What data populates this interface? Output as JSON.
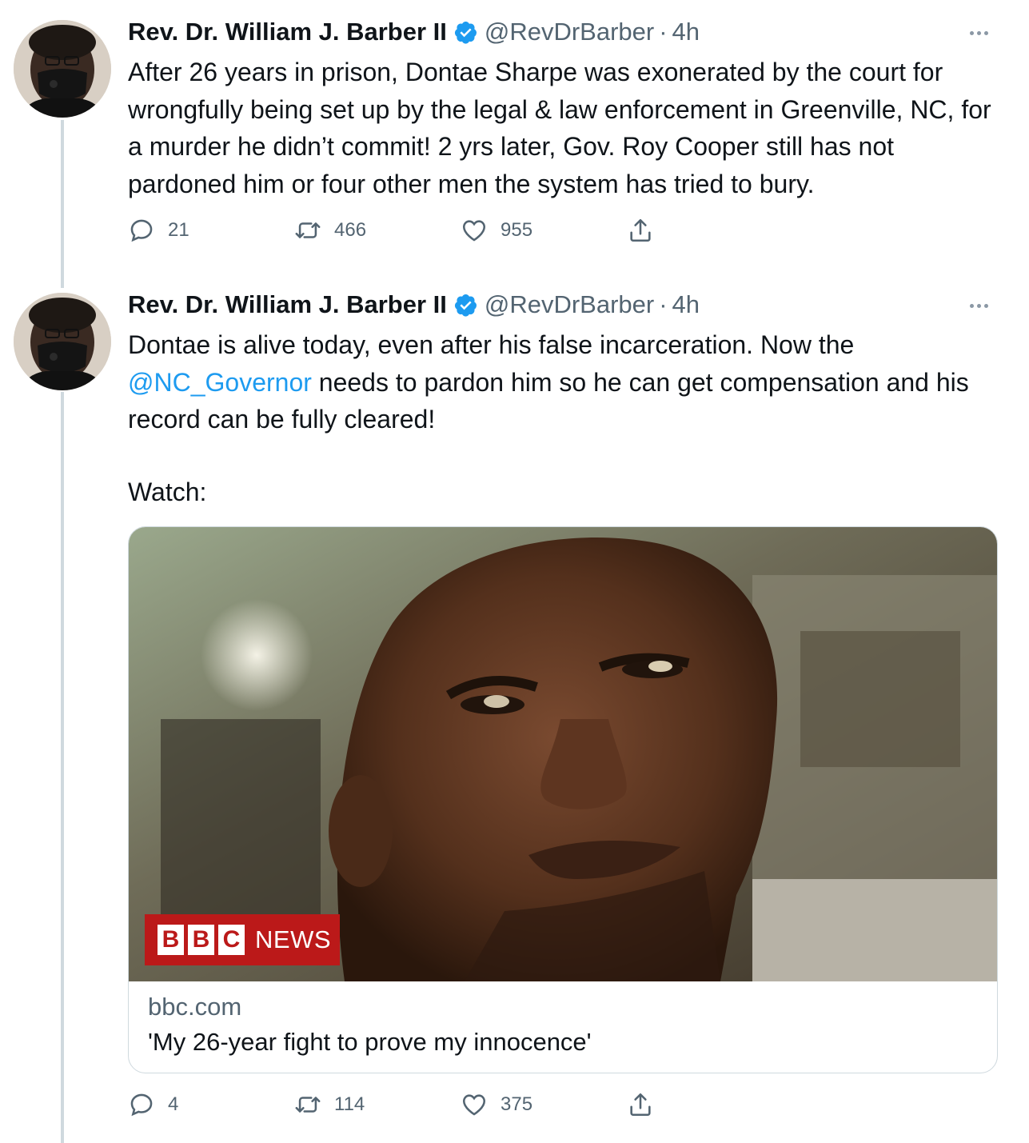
{
  "tweets": [
    {
      "author_name": "Rev. Dr. William J. Barber II",
      "handle": "@RevDrBarber",
      "separator": "·",
      "time": "4h",
      "text": "After 26 years in prison, Dontae Sharpe was exonerated by the court for wrongfully being set up by the legal & law enforcement in Greenville, NC, for a murder he didn’t commit! 2 yrs later, Gov. Roy Cooper still has not pardoned him or four other men the system has tried to bury.",
      "replies": "21",
      "retweets": "466",
      "likes": "955"
    },
    {
      "author_name": "Rev. Dr. William J. Barber II",
      "handle": "@RevDrBarber",
      "separator": "·",
      "time": "4h",
      "text_before_mention": "Dontae is alive today, even after his false incarceration. Now the ",
      "mention": "@NC_Governor",
      "text_after_mention": " needs to pardon him so he can get compensation and his record can be fully cleared!",
      "text_line2": "Watch:",
      "replies": "4",
      "retweets": "114",
      "likes": "375",
      "card": {
        "domain": "bbc.com",
        "title": "'My 26-year fight to prove my innocence'",
        "badge_letters": [
          "B",
          "B",
          "C"
        ],
        "badge_word": "NEWS"
      }
    }
  ],
  "icons": {
    "verified": "verified-badge-icon",
    "reply": "reply-icon",
    "retweet": "retweet-icon",
    "like": "heart-icon",
    "share": "share-icon",
    "more": "more-icon"
  },
  "colors": {
    "accent": "#1d9bf0",
    "muted": "#536471",
    "text": "#0f1419",
    "thread_line": "#cfd9de",
    "bbc_red": "#bb1919"
  }
}
